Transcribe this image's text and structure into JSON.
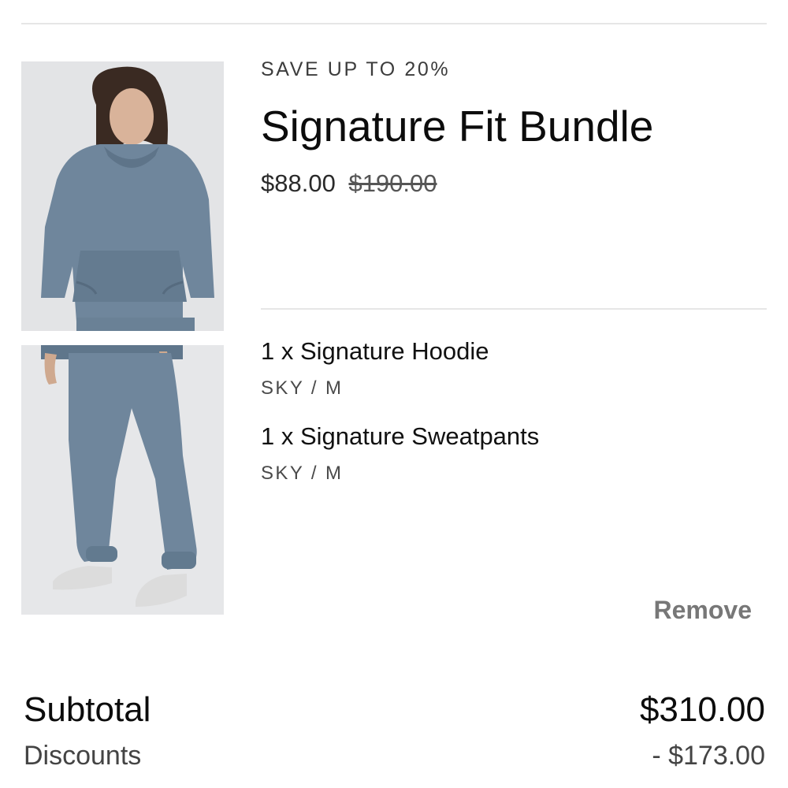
{
  "product": {
    "promo": "SAVE UP TO 20%",
    "title": "Signature Fit Bundle",
    "price": "$88.00",
    "original_price": "$190.00",
    "items": [
      {
        "name": "1 x Signature Hoodie",
        "variant": "SKY / M"
      },
      {
        "name": "1 x Signature Sweatpants",
        "variant": "SKY / M"
      }
    ],
    "remove_label": "Remove",
    "color": "#6f869c"
  },
  "summary": {
    "subtotal_label": "Subtotal",
    "subtotal_value": "$310.00",
    "discounts_label": "Discounts",
    "discounts_value": "- $173.00"
  }
}
